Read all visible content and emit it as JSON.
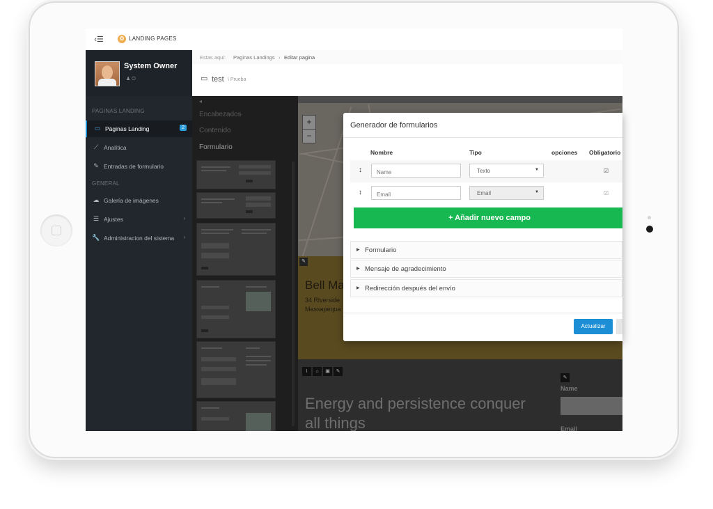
{
  "app": {
    "title": "LANDING PAGES",
    "menu_toggle": "‹☰",
    "logo_glyph": "❂"
  },
  "user": {
    "name": "System Owner",
    "icons": "♟  ⏻"
  },
  "sidebar": {
    "section_landing": "PAGINAS LANDING",
    "section_general": "GENERAL",
    "items": [
      {
        "label": "Páginas Landing",
        "icon": "laptop-icon",
        "glyph": "▭",
        "badge": "2"
      },
      {
        "label": "Analítica",
        "icon": "chart-icon",
        "glyph": "⟋"
      },
      {
        "label": "Entradas de formulario",
        "icon": "edit-icon",
        "glyph": "✎"
      },
      {
        "label": "Galería de imágenes",
        "icon": "cloud-icon",
        "glyph": "☁"
      },
      {
        "label": "Ajustes",
        "icon": "sliders-icon",
        "glyph": "☰",
        "chevron": "›"
      },
      {
        "label": "Administracion del sistema",
        "icon": "wrench-icon",
        "glyph": "🔧",
        "chevron": "›"
      }
    ]
  },
  "breadcrumb": {
    "prefix": "Estas aqui:",
    "parent": "Paginas Landings",
    "sep": "›",
    "current": "Editar pagina"
  },
  "page": {
    "title": "test",
    "subtitle": "\\ Prueba",
    "icon_glyph": "▭"
  },
  "editor": {
    "collapse": "◂",
    "tabs": [
      "Encabezados",
      "Contenido",
      "Formulario"
    ],
    "business_name": "Bell Ma",
    "address_line1": "34 Riverside",
    "address_line2": "Massapequa",
    "slogan": "Energy and persistence conquer all things",
    "form_name_label": "Name",
    "form_email_label": "Email",
    "zoom_in": "+",
    "zoom_out": "−",
    "edit_glyph": "✎",
    "tools": [
      "I",
      "⌂",
      "▣",
      "✎"
    ]
  },
  "modal": {
    "title": "Generador de formularios",
    "columns": {
      "name": "Nombre",
      "type": "Tipo",
      "options": "opciones",
      "required": "Obligatorio"
    },
    "rows": [
      {
        "drag": "↕",
        "name_placeholder": "Name",
        "type": "Texto",
        "required": "☑",
        "caret": "▼"
      },
      {
        "drag": "↕",
        "name_placeholder": "Email",
        "type": "Email",
        "required": "☑",
        "caret": "▼"
      }
    ],
    "add_button": "+ Añadir nuevo campo",
    "sections": [
      "Formulario",
      "Mensaje de agradecimiento",
      "Redirección después del envío"
    ],
    "section_glyph": "▶",
    "update_button": "Actualizar"
  },
  "colors": {
    "accent": "#1b8ed6",
    "add_green": "#17b751",
    "sidebar": "#22272e"
  }
}
